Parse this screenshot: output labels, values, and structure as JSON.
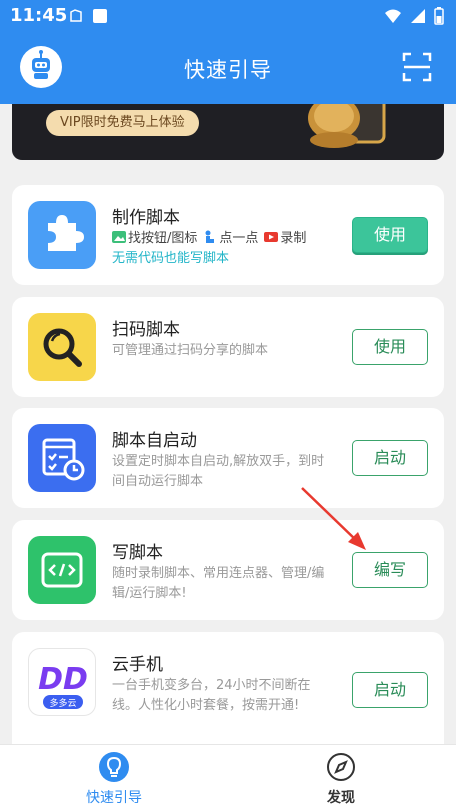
{
  "status_bar": {
    "time": "11:45"
  },
  "header": {
    "title": "快速引导"
  },
  "banner": {
    "vip_text": "VIP限时免费马上体验"
  },
  "cards": [
    {
      "title": "制作脚本",
      "features": [
        "找按钮/图标",
        "点一点",
        "录制"
      ],
      "tagline": "无需代码也能写脚本",
      "button": "使用",
      "icon": "puzzle-icon"
    },
    {
      "title": "扫码脚本",
      "description": "可管理通过扫码分享的脚本",
      "button": "使用",
      "icon": "magnifier-icon"
    },
    {
      "title": "脚本自启动",
      "description": "设置定时脚本自启动,解放双手，到时间自动运行脚本",
      "button": "启动",
      "icon": "schedule-icon"
    },
    {
      "title": "写脚本",
      "description": "随时录制脚本、常用连点器、管理/编辑/运行脚本!",
      "button": "编写",
      "icon": "code-icon"
    },
    {
      "title": "云手机",
      "description": "一台手机变多台，24小时不间断在线。人性化小时套餐，按需开通!",
      "button": "启动",
      "icon": "duoduoyun-logo",
      "logo_text": "多多云"
    }
  ],
  "bottom_nav": [
    {
      "label": "快速引导",
      "icon": "lightbulb-icon",
      "active": true
    },
    {
      "label": "发现",
      "icon": "compass-icon",
      "active": false
    }
  ],
  "colors": {
    "primary": "#2f8cf0",
    "button_green": "#2a8c58",
    "filled_button": "#3cc59a",
    "tagline": "#22b5c8",
    "arrow": "#e8392f"
  }
}
